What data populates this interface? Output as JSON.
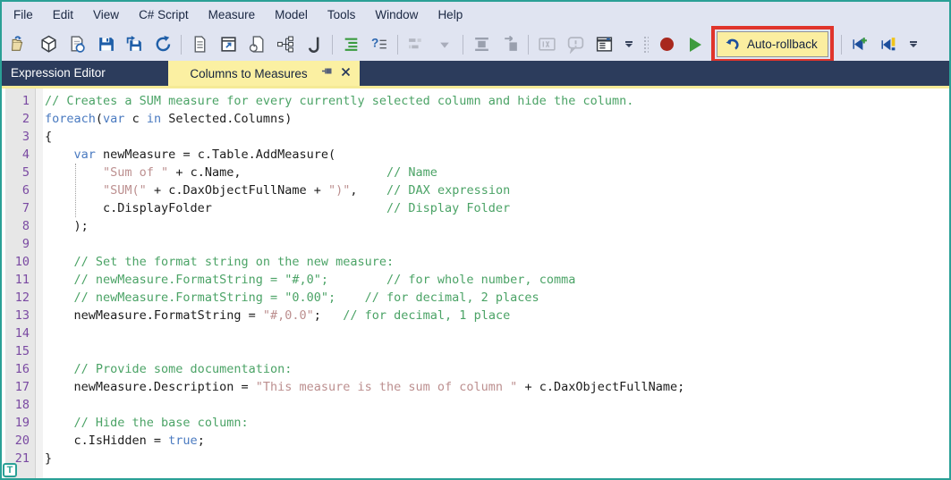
{
  "window": {
    "title_pane": "Expression Editor",
    "border_color": "#2aa096"
  },
  "menu": {
    "items": [
      "File",
      "Edit",
      "View",
      "C# Script",
      "Measure",
      "Model",
      "Tools",
      "Window",
      "Help"
    ]
  },
  "toolbar": {
    "auto_rollback_label": "Auto-rollback",
    "annotation_color": "#e0342b",
    "record_color": "#a8281e",
    "play_color": "#3e9b3e",
    "icons": [
      "open-model-icon",
      "deploy-cube-icon",
      "save-deploy-icon",
      "save-icon",
      "save-as-icon",
      "refresh-icon",
      "new-script-icon",
      "open-script-window-icon",
      "revert-script-icon",
      "model-tree-icon",
      "format-script-icon",
      "format-dax-icon",
      "comment-help-icon",
      "perspective-select-icon",
      "perspective-dropdown-icon",
      "column-insert-icon",
      "goto-block-icon",
      "expression-brackets-icon",
      "warning-bubble-icon",
      "form-preferences-icon",
      "toolbar-options-icon",
      "drag-grip",
      "record-macro-icon",
      "run-script-icon",
      "undo-icon",
      "run-add-icon",
      "run-highlight-icon",
      "toolbar-overflow-icon"
    ]
  },
  "tabs": {
    "pane_title": "Expression Editor",
    "active_tab_label": "Columns to Measures",
    "active_tab_color": "#fbf0a2",
    "tab_icons": [
      "pin-icon",
      "close-icon"
    ]
  },
  "editor": {
    "line_count": 21,
    "colors": {
      "plain": "#1c1c1c",
      "keyword": "#4a7ac0",
      "string": "#bc8f8f",
      "comment": "#4ba366",
      "line_number": "#7a4aa2"
    },
    "lines": [
      [
        [
          "c",
          "// Creates a SUM measure for every currently selected column and hide the column."
        ]
      ],
      [
        [
          "k",
          "foreach"
        ],
        [
          "p",
          "("
        ],
        [
          "k",
          "var"
        ],
        [
          "p",
          " c "
        ],
        [
          "k",
          "in"
        ],
        [
          "p",
          " Selected.Columns)"
        ]
      ],
      [
        [
          "p",
          "{"
        ]
      ],
      [
        [
          "p",
          "    "
        ],
        [
          "k",
          "var"
        ],
        [
          "p",
          " newMeasure = c.Table.AddMeasure("
        ]
      ],
      [
        [
          "p",
          "        "
        ],
        [
          "s",
          "\"Sum of \""
        ],
        [
          "p",
          " + c.Name,                    "
        ],
        [
          "c",
          "// Name"
        ]
      ],
      [
        [
          "p",
          "        "
        ],
        [
          "s",
          "\"SUM(\""
        ],
        [
          "p",
          " + c.DaxObjectFullName + "
        ],
        [
          "s",
          "\")\""
        ],
        [
          "p",
          ",    "
        ],
        [
          "c",
          "// DAX expression"
        ]
      ],
      [
        [
          "p",
          "        c.DisplayFolder                        "
        ],
        [
          "c",
          "// Display Folder"
        ]
      ],
      [
        [
          "p",
          "    );"
        ]
      ],
      [],
      [
        [
          "p",
          "    "
        ],
        [
          "c",
          "// Set the format string on the new measure:"
        ]
      ],
      [
        [
          "p",
          "    "
        ],
        [
          "c",
          "// newMeasure.FormatString = \"#,0\";        // for whole number, comma"
        ]
      ],
      [
        [
          "p",
          "    "
        ],
        [
          "c",
          "// newMeasure.FormatString = \"0.00\";    // for decimal, 2 places"
        ]
      ],
      [
        [
          "p",
          "    newMeasure.FormatString = "
        ],
        [
          "s",
          "\"#,0.0\""
        ],
        [
          "p",
          ";   "
        ],
        [
          "c",
          "// for decimal, 1 place"
        ]
      ],
      [],
      [],
      [
        [
          "p",
          "    "
        ],
        [
          "c",
          "// Provide some documentation:"
        ]
      ],
      [
        [
          "p",
          "    newMeasure.Description = "
        ],
        [
          "s",
          "\"This measure is the sum of column \""
        ],
        [
          "p",
          " + c.DaxObjectFullName;"
        ]
      ],
      [],
      [
        [
          "p",
          "    "
        ],
        [
          "c",
          "// Hide the base column:"
        ]
      ],
      [
        [
          "p",
          "    c.IsHidden = "
        ],
        [
          "k",
          "true"
        ],
        [
          "p",
          ";"
        ]
      ],
      [
        [
          "p",
          "}"
        ]
      ]
    ],
    "badge_letter": "T"
  }
}
